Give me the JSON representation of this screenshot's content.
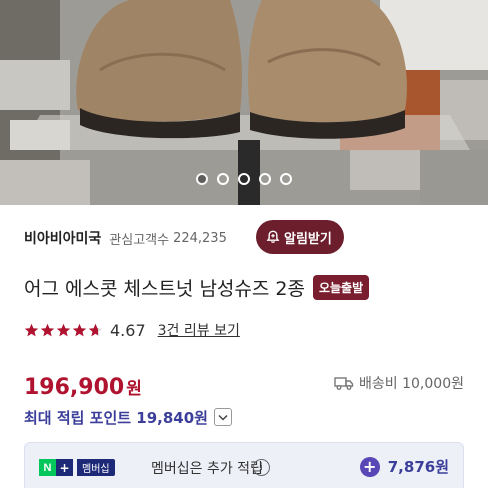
{
  "gallery": {
    "image_icon": "product-photo",
    "slide_count": 5,
    "active_slide": 1
  },
  "seller": {
    "name": "비아비아미국",
    "follow_label": "관심고객수",
    "follow_count": "224,235",
    "alarm_label": "알림받기"
  },
  "product": {
    "title": "어그 에스콧 체스트넛 남성슈즈 2종",
    "badge": "오늘출발"
  },
  "rating": {
    "score": "4.67",
    "stars": 4.67,
    "review_link": "3건 리뷰 보기"
  },
  "price": {
    "amount": "196,900",
    "unit": "원"
  },
  "shipping": {
    "text": "배송비 10,000원"
  },
  "points": {
    "max_text": "최대 적립 포인트 19,840원"
  },
  "membership": {
    "n_label": "N",
    "plus_label": "+",
    "tag": "멤버십",
    "text": "멤버십은 추가 적립",
    "info": "i",
    "points": "7,876원"
  },
  "colors": {
    "accent_maroon": "#6d1e2c",
    "price_red": "#b0132f",
    "points_blue": "#3b3f9a",
    "naver_green": "#03c75a",
    "star_color": "#b0132f"
  }
}
